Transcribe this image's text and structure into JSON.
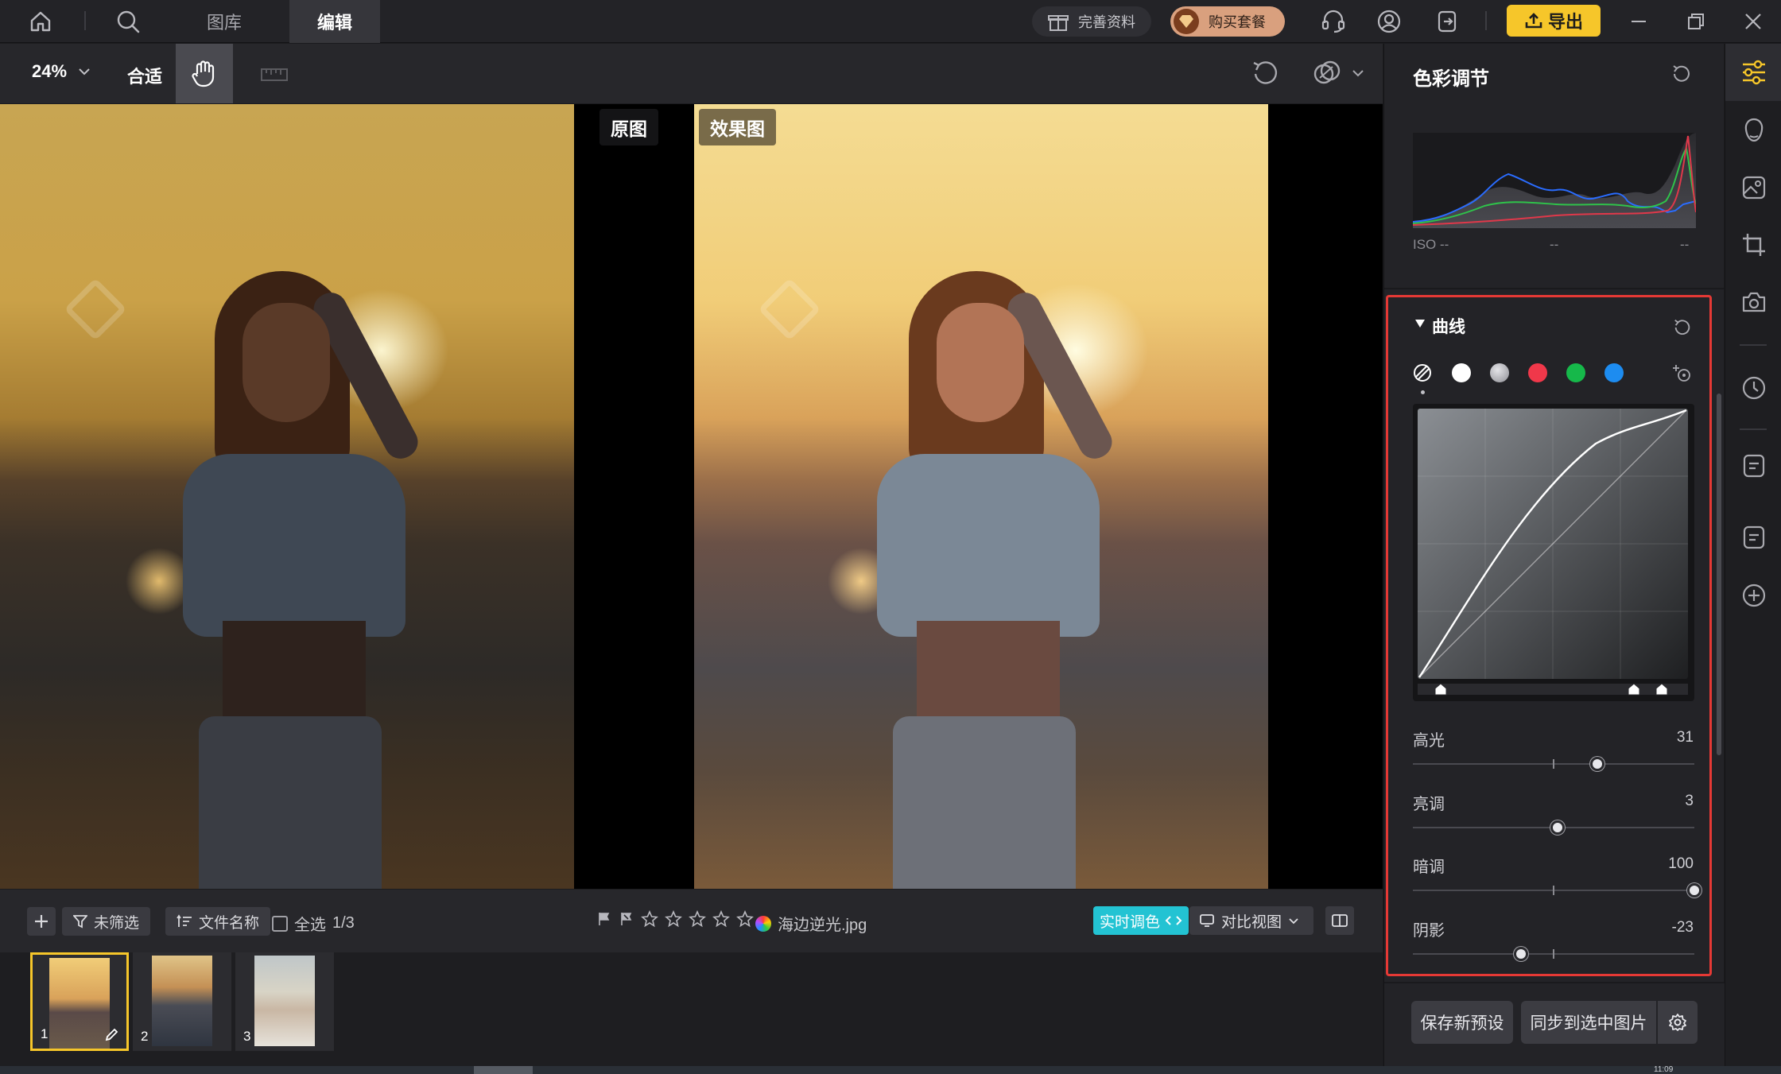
{
  "topbar": {
    "tabs": [
      {
        "label": "图库",
        "active": false
      },
      {
        "label": "编辑",
        "active": true
      }
    ],
    "complete_profile_label": "完善资料",
    "buy_package_label": "购买套餐",
    "export_label": "导出"
  },
  "toolbar": {
    "zoom_value": "24%",
    "fit_label": "合适"
  },
  "canvas": {
    "original_label": "原图",
    "result_label": "效果图"
  },
  "filmbar": {
    "filter_label": "未筛选",
    "sort_label": "文件名称",
    "select_all_label": "全选",
    "selection_count": "1/3",
    "rating_stars": 0,
    "filename": "海边逆光.jpg",
    "live_color_label": "实时调色",
    "view_mode_label": "对比视图"
  },
  "thumbnails": [
    {
      "number": "1",
      "selected": true
    },
    {
      "number": "2",
      "selected": false
    },
    {
      "number": "3",
      "selected": false
    }
  ],
  "right_panel": {
    "title": "色彩调节",
    "histogram": {
      "iso_label": "ISO --",
      "readout_2": "--",
      "readout_3": "--"
    },
    "curve": {
      "title": "曲线",
      "channels": [
        {
          "name": "luminance-composite",
          "color": "#ffffff"
        },
        {
          "name": "white",
          "color": "#ffffff"
        },
        {
          "name": "gray",
          "color": "#9e9ea4"
        },
        {
          "name": "red",
          "color": "#f0384a"
        },
        {
          "name": "green",
          "color": "#16b84a"
        },
        {
          "name": "blue",
          "color": "#1d8cf0"
        }
      ]
    },
    "sliders": [
      {
        "label": "高光",
        "value": "31",
        "fraction": 0.655
      },
      {
        "label": "亮调",
        "value": "3",
        "fraction": 0.515
      },
      {
        "label": "暗调",
        "value": "100",
        "fraction": 1.0
      },
      {
        "label": "阴影",
        "value": "-23",
        "fraction": 0.385
      }
    ],
    "save_preset_label": "保存新预设",
    "sync_label": "同步到选中图片"
  },
  "colors": {
    "accent": "#f6c62a",
    "highlight_border": "#e53935",
    "live_color": "#23c3d3"
  },
  "status": {
    "time": "11:09"
  }
}
